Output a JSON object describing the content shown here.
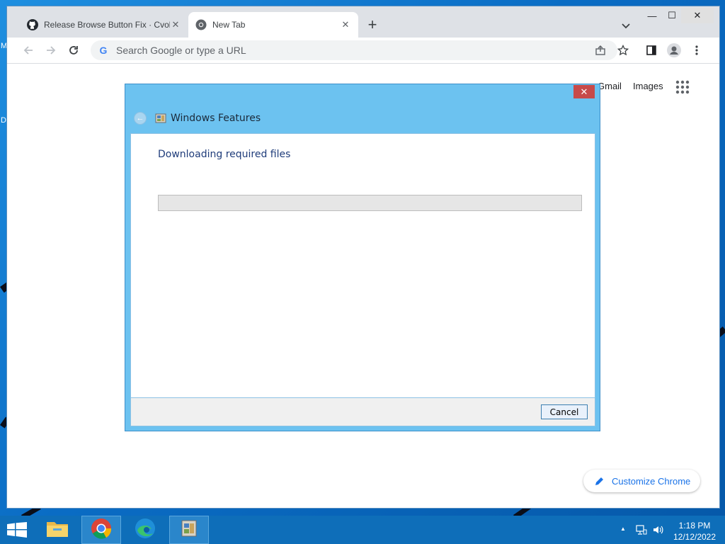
{
  "desktop": {
    "edge_letters": [
      "M",
      "D"
    ]
  },
  "browser": {
    "tabs": [
      {
        "title": "Release Browse Button Fix · Cvolt",
        "favicon": "github-icon",
        "active": false
      },
      {
        "title": "New Tab",
        "favicon": "chrome-icon",
        "active": true
      }
    ],
    "new_tab_symbol": "+",
    "window_controls": {
      "minimize": "—",
      "maximize": "☐",
      "close": "✕"
    },
    "omnibox": {
      "placeholder": "Search Google or type a URL",
      "value": ""
    },
    "ntp": {
      "gmail": "Gmail",
      "images": "Images",
      "customize": "Customize Chrome"
    }
  },
  "dialog": {
    "title": "Windows Features",
    "heading": "Downloading required files",
    "progress": 0,
    "cancel_label": "Cancel",
    "close_symbol": "✕",
    "back_symbol": "←"
  },
  "taskbar": {
    "apps": [
      {
        "name": "file-explorer",
        "active": false
      },
      {
        "name": "chrome",
        "active": false
      },
      {
        "name": "edge",
        "active": false
      },
      {
        "name": "windows-features",
        "active": true
      }
    ],
    "clock": {
      "time": "1:18 PM",
      "date": "12/12/2022"
    },
    "tray_up_arrow": "▲"
  },
  "colors": {
    "dialog_frame": "#6cc2f0",
    "taskbar": "#0e6eb9",
    "link_blue": "#1a73e8",
    "dialog_heading": "#1f3c7a"
  }
}
